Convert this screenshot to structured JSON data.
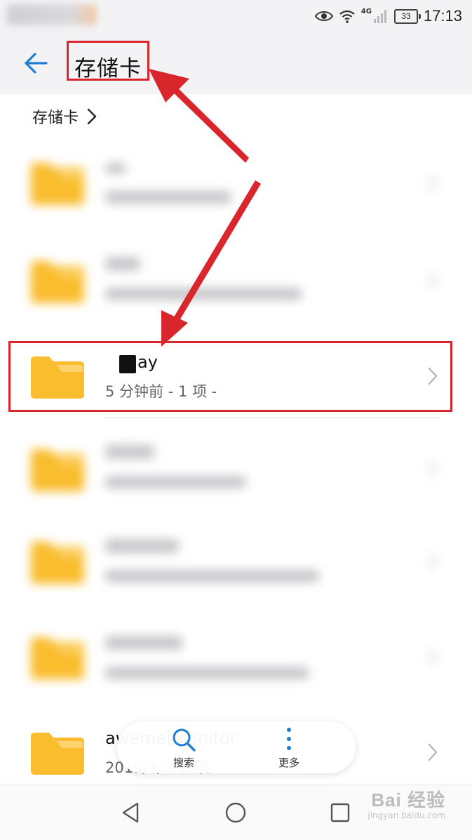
{
  "status_bar": {
    "time": "17:13",
    "battery": "33",
    "network": "4G"
  },
  "header": {
    "title": "存储卡"
  },
  "breadcrumb": {
    "label": "存储卡"
  },
  "files": [
    {
      "name": "",
      "meta": "",
      "blurred": true
    },
    {
      "name": "",
      "meta": "",
      "blurred": true
    },
    {
      "name": "ay",
      "meta": "5 分钟前 - 1 项 -",
      "blurred": false
    },
    {
      "name": "",
      "meta": "",
      "blurred": true
    },
    {
      "name": "",
      "meta": "",
      "blurred": true
    },
    {
      "name": "",
      "meta": "",
      "blurred": true
    },
    {
      "name": "awemeimonitor",
      "meta": "2019/9/... 0 项",
      "blurred": false
    }
  ],
  "toolbar": {
    "search_label": "搜索",
    "more_label": "更多"
  },
  "colors": {
    "folder": "#f9bd2d",
    "folder_tab": "#fcd36f",
    "accent": "#1f7fd1",
    "annotation": "#d9262c"
  },
  "watermark": {
    "main": "Bai 经验",
    "sub": "jingyan.baidu.com"
  }
}
